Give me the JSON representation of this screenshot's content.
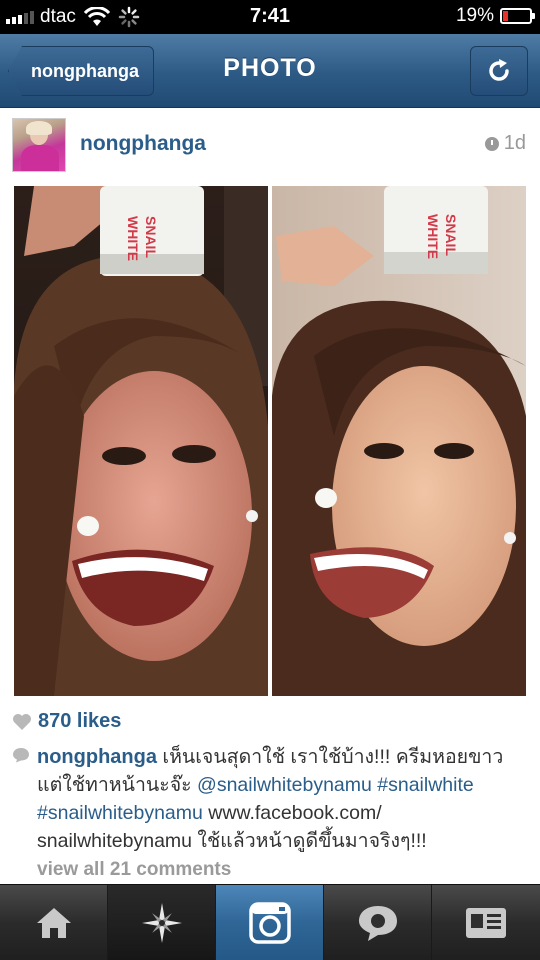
{
  "status_bar": {
    "carrier": "dtac",
    "time": "7:41",
    "battery_text": "19%",
    "battery_level": 0.19,
    "battery_color": "#e8312a"
  },
  "nav": {
    "back_label": "nongphanga",
    "title": "PHOTO",
    "refresh_icon": "refresh-icon"
  },
  "post": {
    "username": "nongphanga",
    "time_ago": "1d",
    "likes": "870 likes",
    "caption": {
      "user": "nongphanga",
      "text_1": " เห็นเจนสุดาใช้ เราใช้บ้าง!!! ครีมหอยขาว แต่ใช้ทาหน้านะจ๊ะ ",
      "mention": "@snailwhitebynamu",
      "hashtag_1": "#snailwhite",
      "hashtag_2": "#snailwhitebynamu",
      "text_2": " www.facebook.com/ snailwhitebynamu ใช้แล้วหน้าดูดีขึ้นมาจริงๆ!!!"
    },
    "view_comments": "view all 21 comments",
    "photo": {
      "jar_label_left": [
        "SNAIL",
        "WHITE"
      ],
      "jar_label_right": [
        "SNAIL",
        "WHITE"
      ]
    }
  },
  "tabbar": {
    "tabs": [
      "home-icon",
      "explore-icon",
      "camera-icon",
      "news-icon",
      "profile-icon"
    ],
    "active_color": "#2f6697"
  }
}
